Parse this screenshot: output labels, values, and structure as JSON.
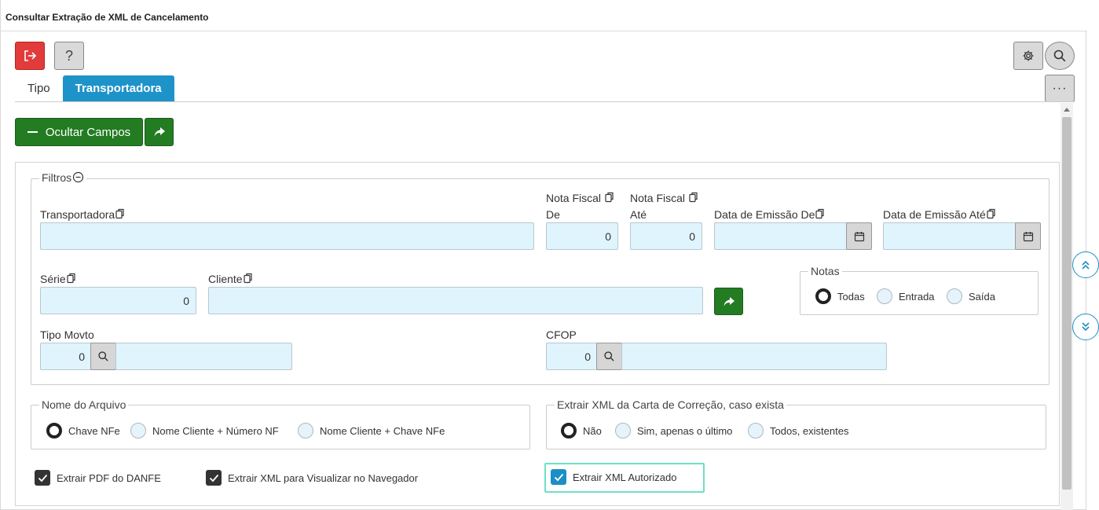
{
  "window": {
    "title": "Consultar Extração de XML de Cancelamento"
  },
  "toolbar": {
    "help_label": "?",
    "more_label": "···"
  },
  "tabs": [
    {
      "label": "Tipo",
      "active": false
    },
    {
      "label": "Transportadora",
      "active": true
    }
  ],
  "actions": {
    "hide_fields_label": "Ocultar Campos"
  },
  "filters": {
    "legend": "Filtros",
    "transportadora": {
      "label": "Transportadora",
      "value": ""
    },
    "nf_de": {
      "label_line1": "Nota Fiscal",
      "label_line2": "De",
      "value": "0"
    },
    "nf_ate": {
      "label_line1": "Nota Fiscal",
      "label_line2": "Até",
      "value": "0"
    },
    "data_emissao_de": {
      "label": "Data de Emissão De",
      "value": ""
    },
    "data_emissao_ate": {
      "label": "Data de Emissão Até",
      "value": ""
    },
    "serie": {
      "label": "Série",
      "value": "0"
    },
    "cliente": {
      "label": "Cliente",
      "value": ""
    },
    "tipo_movto": {
      "label": "Tipo Movto",
      "value": "0",
      "desc": ""
    },
    "cfop": {
      "label": "CFOP",
      "value": "0",
      "desc": ""
    },
    "notas": {
      "legend": "Notas",
      "options": [
        "Todas",
        "Entrada",
        "Saída"
      ],
      "selected": "Todas"
    }
  },
  "nome_arquivo": {
    "legend": "Nome do Arquivo",
    "options": [
      "Chave NFe",
      "Nome Cliente + Número NF",
      "Nome Cliente + Chave NFe"
    ],
    "selected": "Chave NFe"
  },
  "carta_correcao": {
    "legend": "Extrair XML da Carta de Correção, caso exista",
    "options": [
      "Não",
      "Sim, apenas o último",
      "Todos, existentes"
    ],
    "selected": "Não"
  },
  "checkboxes": [
    {
      "label": "Extrair PDF do DANFE",
      "checked": true
    },
    {
      "label": "Extrair XML para Visualizar no Navegador",
      "checked": true
    },
    {
      "label": "Extrair XML Autorizado",
      "checked": true
    }
  ],
  "colors": {
    "accent": "#1d93c9",
    "success": "#237c22",
    "danger": "#e23b3b",
    "input_bg": "#e0f4fd"
  }
}
